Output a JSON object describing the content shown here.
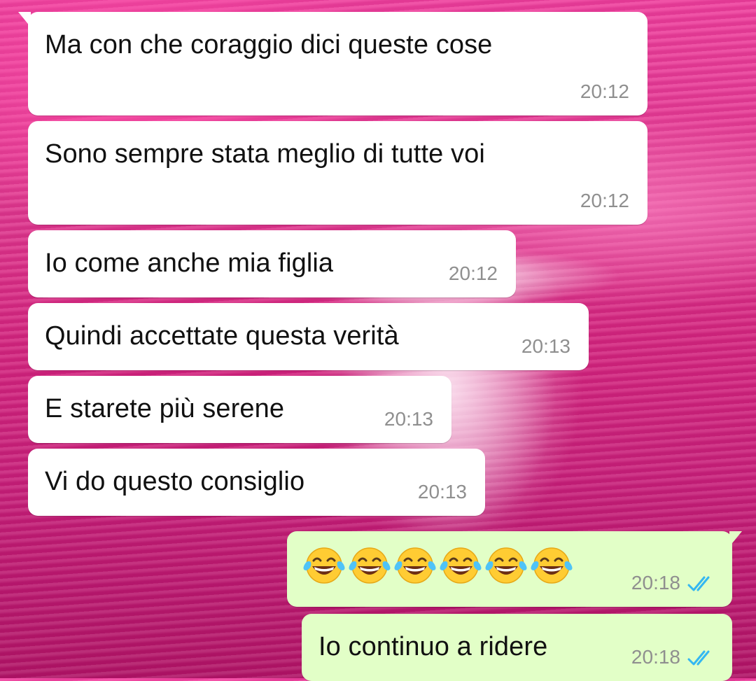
{
  "messages": [
    {
      "id": "m1",
      "direction": "incoming",
      "text": "Ma con che coraggio dici queste cose",
      "time": "20:12"
    },
    {
      "id": "m2",
      "direction": "incoming",
      "text": "Sono sempre stata meglio di tutte voi",
      "time": "20:12"
    },
    {
      "id": "m3",
      "direction": "incoming",
      "text": "Io come anche mia figlia",
      "time": "20:12"
    },
    {
      "id": "m4",
      "direction": "incoming",
      "text": "Quindi accettate questa verità",
      "time": "20:13"
    },
    {
      "id": "m5",
      "direction": "incoming",
      "text": "E starete più serene",
      "time": "20:13"
    },
    {
      "id": "m6",
      "direction": "incoming",
      "text": "Vi do questo consiglio",
      "time": "20:13"
    },
    {
      "id": "m7",
      "direction": "outgoing",
      "emoji": "face-with-tears-of-joy",
      "emoji_count": 6,
      "time": "20:18",
      "status": "read"
    },
    {
      "id": "m8",
      "direction": "outgoing",
      "text": "Io continuo a ridere",
      "time": "20:18",
      "status": "read"
    }
  ],
  "colors": {
    "incoming_bubble": "#ffffff",
    "outgoing_bubble": "#e2ffc7",
    "read_check": "#34b7f1",
    "timestamp": "#8f8f8f",
    "wallpaper": "#e0398f"
  }
}
